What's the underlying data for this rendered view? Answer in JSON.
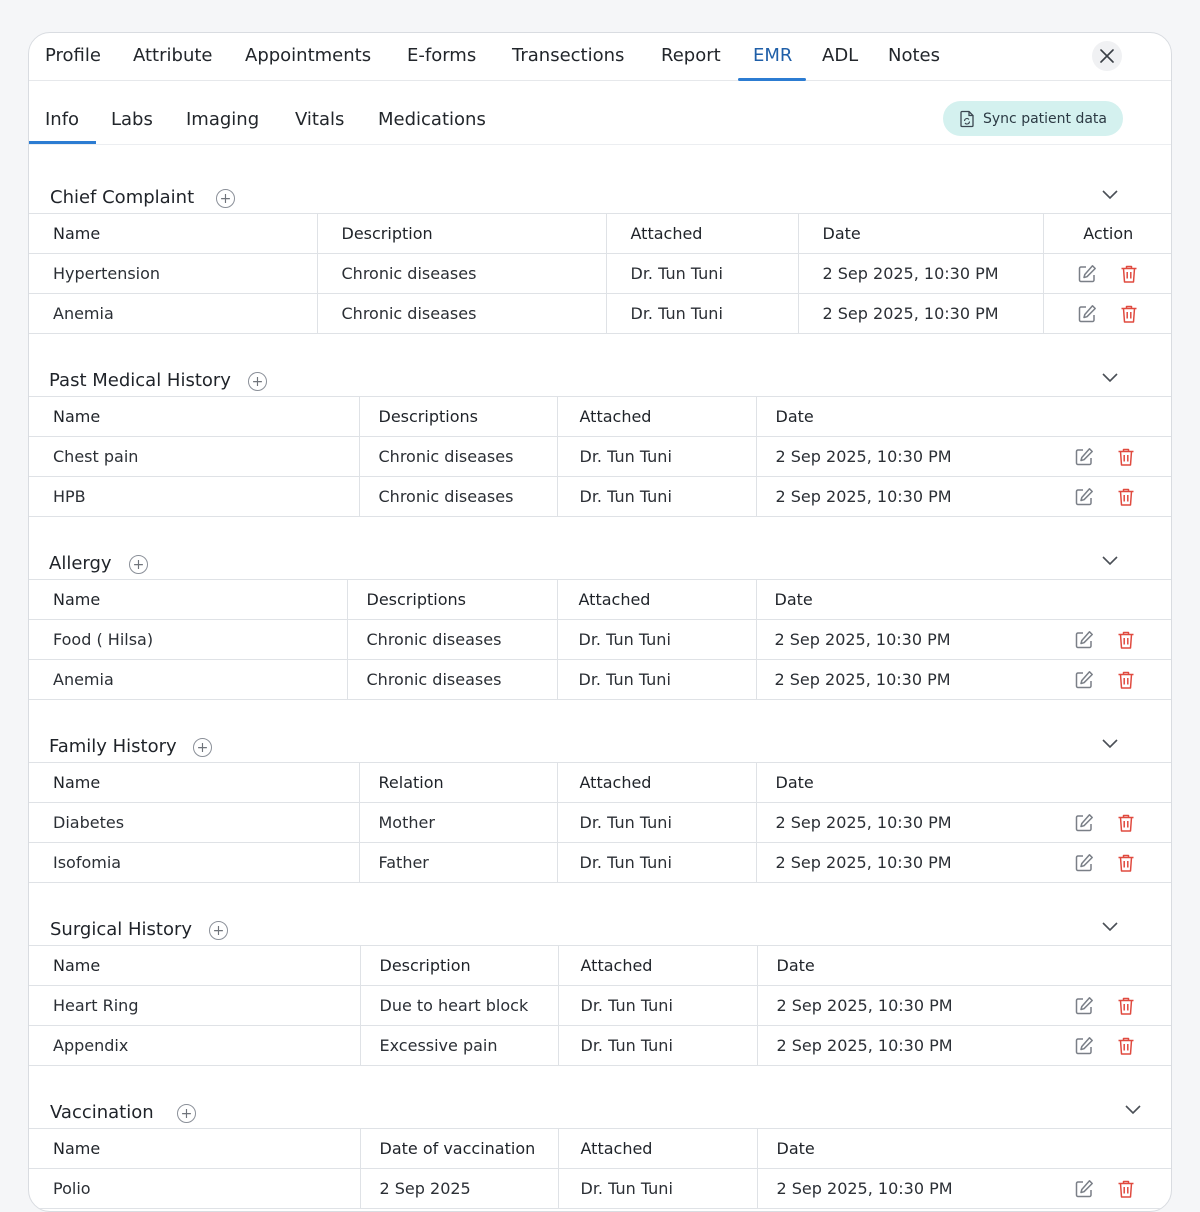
{
  "top_tabs": [
    "Profile",
    "Attribute",
    "Appointments",
    "E-forms",
    "Transections",
    "Report",
    "EMR",
    "ADL",
    "Notes"
  ],
  "active_top_tab": "EMR",
  "sub_tabs": [
    "Info",
    "Labs",
    "Imaging",
    "Vitals",
    "Medications"
  ],
  "active_sub_tab": "Info",
  "sync_button": {
    "label": "Sync patient data"
  },
  "colors": {
    "accent": "#2c7cd2",
    "delete": "#e04a3f",
    "sync_bg": "#d4f1ef"
  },
  "sections": {
    "chief_complaint": {
      "title": "Chief Complaint",
      "headers": [
        "Name",
        "Description",
        "Attached",
        "Date",
        "Action"
      ],
      "rows": [
        [
          "Hypertension",
          "Chronic diseases",
          "Dr. Tun Tuni",
          "2 Sep 2025, 10:30 PM"
        ],
        [
          "Anemia",
          "Chronic diseases",
          "Dr. Tun Tuni",
          "2 Sep 2025, 10:30 PM"
        ]
      ]
    },
    "past_medical_history": {
      "title": "Past Medical History",
      "headers": [
        "Name",
        "Descriptions",
        "Attached",
        "Date"
      ],
      "rows": [
        [
          "Chest pain",
          "Chronic diseases",
          "Dr. Tun Tuni",
          "2 Sep 2025, 10:30 PM"
        ],
        [
          "HPB",
          "Chronic diseases",
          "Dr. Tun Tuni",
          "2 Sep 2025, 10:30 PM"
        ]
      ]
    },
    "allergy": {
      "title": "Allergy",
      "headers": [
        "Name",
        "Descriptions",
        "Attached",
        "Date"
      ],
      "rows": [
        [
          "Food ( Hilsa)",
          "Chronic diseases",
          "Dr. Tun Tuni",
          "2 Sep 2025, 10:30 PM"
        ],
        [
          "Anemia",
          "Chronic diseases",
          "Dr. Tun Tuni",
          "2 Sep 2025, 10:30 PM"
        ]
      ]
    },
    "family_history": {
      "title": "Family History",
      "headers": [
        "Name",
        "Relation",
        "Attached",
        "Date"
      ],
      "rows": [
        [
          "Diabetes",
          "Mother",
          "Dr. Tun Tuni",
          "2 Sep 2025, 10:30 PM"
        ],
        [
          "Isofomia",
          "Father",
          "Dr. Tun Tuni",
          "2 Sep 2025, 10:30 PM"
        ]
      ]
    },
    "surgical_history": {
      "title": "Surgical History",
      "headers": [
        "Name",
        "Description",
        "Attached",
        "Date"
      ],
      "rows": [
        [
          "Heart Ring",
          "Due to heart block",
          "Dr. Tun Tuni",
          "2 Sep 2025, 10:30 PM"
        ],
        [
          "Appendix",
          "Excessive pain",
          "Dr. Tun Tuni",
          "2 Sep 2025, 10:30 PM"
        ]
      ]
    },
    "vaccination": {
      "title": "Vaccination",
      "headers": [
        "Name",
        "Date of vaccination",
        "Attached",
        "Date"
      ],
      "rows": [
        [
          "Polio",
          "2 Sep 2025",
          "Dr. Tun Tuni",
          "2 Sep 2025, 10:30 PM"
        ]
      ]
    }
  }
}
